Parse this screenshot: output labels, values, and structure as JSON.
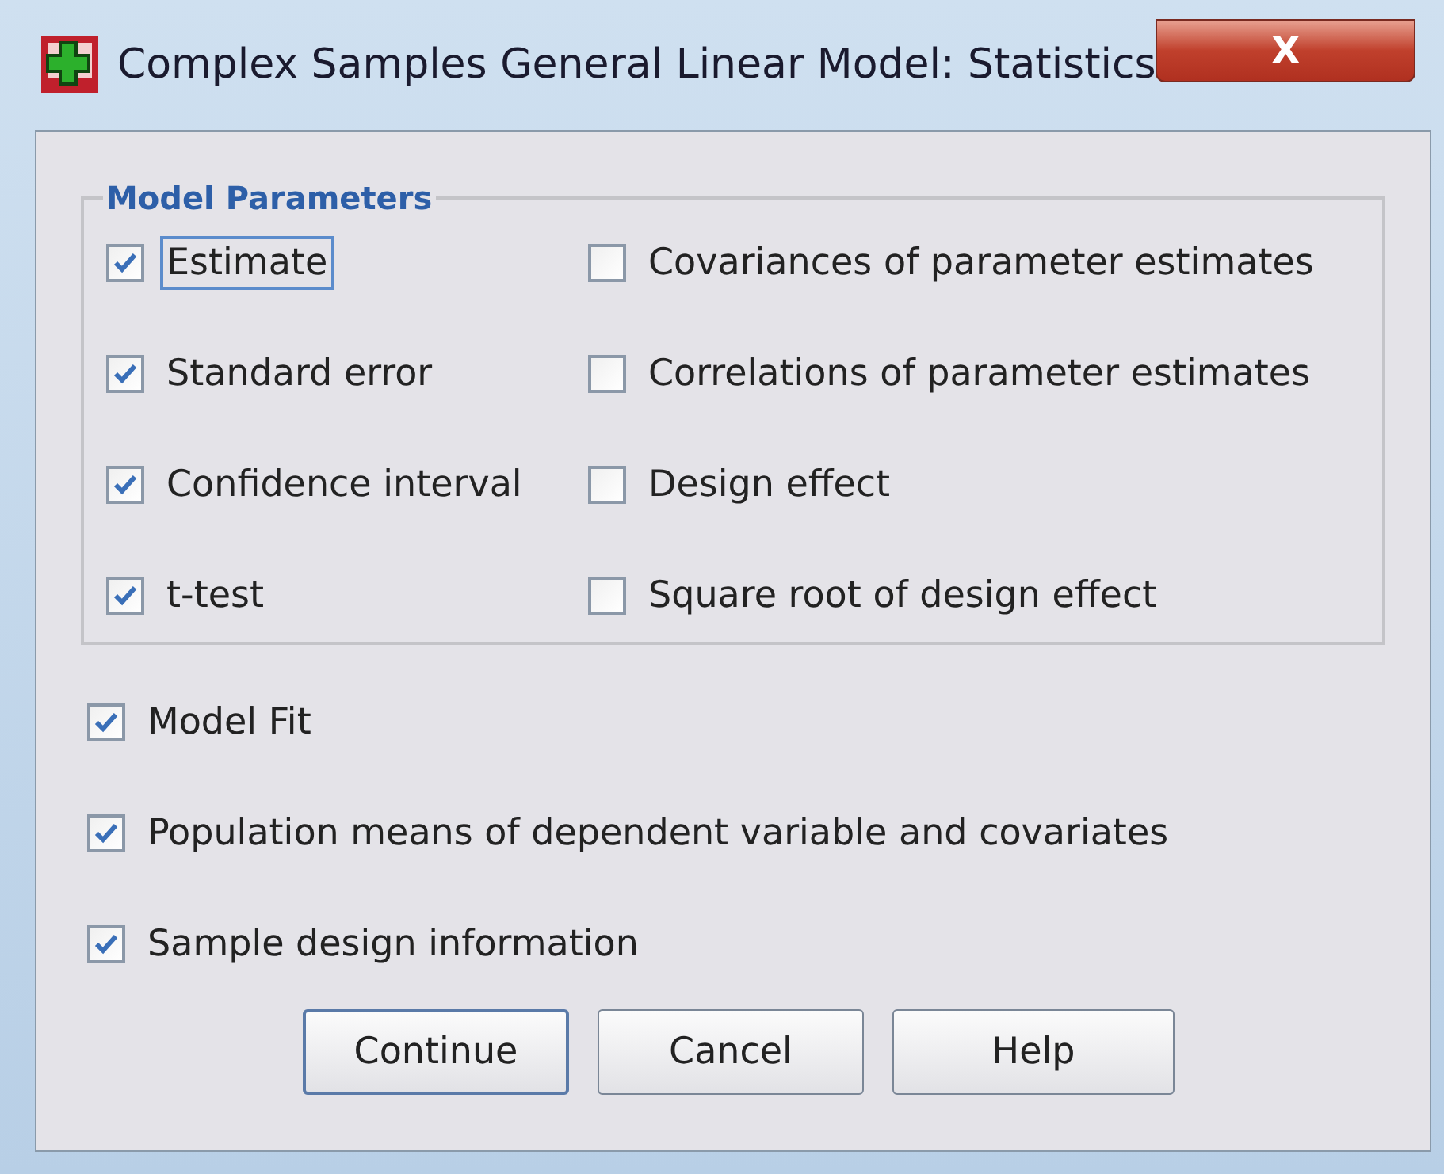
{
  "window": {
    "title": "Complex Samples General Linear Model: Statistics",
    "close": "X"
  },
  "model_parameters": {
    "title": "Model Parameters",
    "columns": [
      [
        {
          "label": "Estimate",
          "checked": true,
          "focused": true
        },
        {
          "label": "Standard error",
          "checked": true,
          "focused": false
        },
        {
          "label": "Confidence interval",
          "checked": true,
          "focused": false
        },
        {
          "label": "t-test",
          "checked": true,
          "focused": false
        }
      ],
      [
        {
          "label": "Covariances of parameter estimates",
          "checked": false,
          "focused": false
        },
        {
          "label": "Correlations of parameter estimates",
          "checked": false,
          "focused": false
        },
        {
          "label": "Design effect",
          "checked": false,
          "focused": false
        },
        {
          "label": "Square root of design effect",
          "checked": false,
          "focused": false
        }
      ]
    ]
  },
  "options": [
    {
      "label": "Model Fit",
      "checked": true,
      "focused": false
    },
    {
      "label": "Population means of dependent variable and covariates",
      "checked": true,
      "focused": false
    },
    {
      "label": "Sample design information",
      "checked": true,
      "focused": false
    }
  ],
  "buttons": [
    {
      "label": "Continue",
      "default": true
    },
    {
      "label": "Cancel",
      "default": false
    },
    {
      "label": "Help",
      "default": false
    }
  ]
}
